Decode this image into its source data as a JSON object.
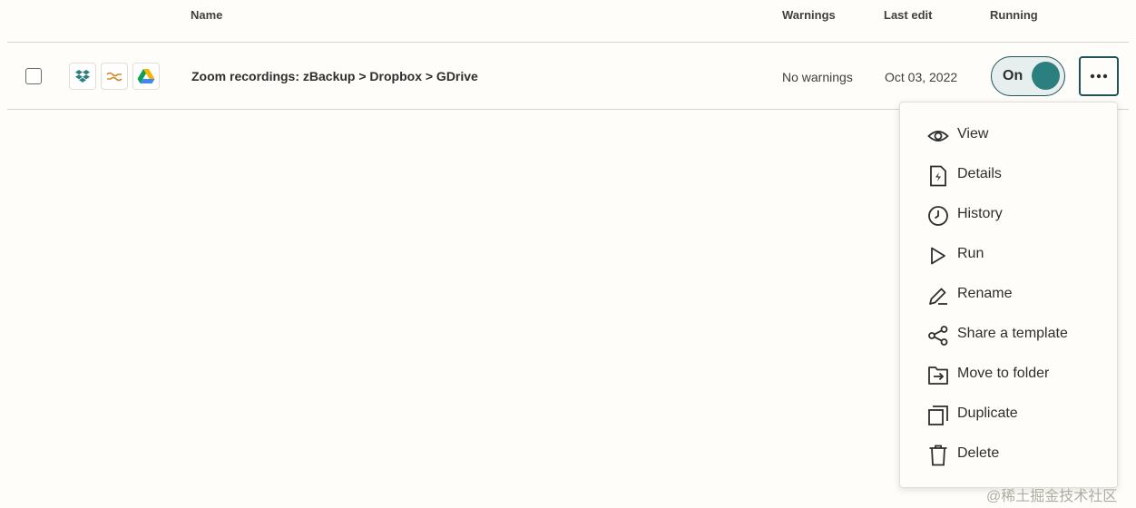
{
  "header": {
    "name": "Name",
    "warnings": "Warnings",
    "last_edit": "Last edit",
    "running": "Running"
  },
  "row": {
    "apps": [
      "dropbox-icon",
      "formatter-icon",
      "google-drive-icon"
    ],
    "name": "Zoom recordings: zBackup > Dropbox > GDrive",
    "warnings": "No warnings",
    "last_edit": "Oct 03, 2022",
    "toggle_label": "On",
    "toggle_on": true
  },
  "menu": {
    "items": [
      {
        "label": "View",
        "icon": "eye-icon"
      },
      {
        "label": "Details",
        "icon": "file-lightning-icon"
      },
      {
        "label": "History",
        "icon": "clock-icon"
      },
      {
        "label": "Run",
        "icon": "play-icon"
      },
      {
        "label": "Rename",
        "icon": "pencil-icon"
      },
      {
        "label": "Share a template",
        "icon": "share-icon"
      },
      {
        "label": "Move to folder",
        "icon": "move-to-folder-icon"
      },
      {
        "label": "Duplicate",
        "icon": "duplicate-icon"
      },
      {
        "label": "Delete",
        "icon": "trash-icon"
      }
    ]
  },
  "watermark": "@稀土掘金技术社区",
  "colors": {
    "accent": "#2b7f7e",
    "accent_border": "#1f5457",
    "background": "#fffdf9",
    "divider": "#d7d3c9"
  }
}
